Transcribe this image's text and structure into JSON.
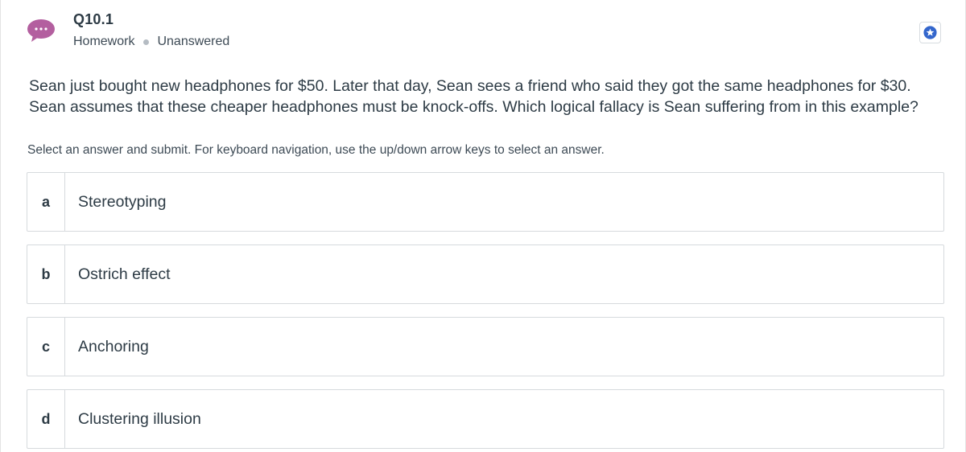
{
  "header": {
    "title": "Q10.1",
    "type": "Homework",
    "status": "Unanswered",
    "avatar_icon": "more-dots-icon",
    "avatar_color": "#b35f9f",
    "star_icon": "star-icon",
    "star_color": "#3366cc"
  },
  "question": {
    "text": "Sean just bought new headphones for $50. Later that day, Sean sees a friend who said they got the same headphones for $30. Sean assumes that these cheaper headphones must be knock-offs. Which logical fallacy is Sean suffering from in this example?"
  },
  "instructions": "Select an answer and submit. For keyboard navigation, use the up/down arrow keys to select an answer.",
  "options": [
    {
      "letter": "a",
      "text": "Stereotyping"
    },
    {
      "letter": "b",
      "text": "Ostrich effect"
    },
    {
      "letter": "c",
      "text": "Anchoring"
    },
    {
      "letter": "d",
      "text": "Clustering illusion"
    }
  ]
}
